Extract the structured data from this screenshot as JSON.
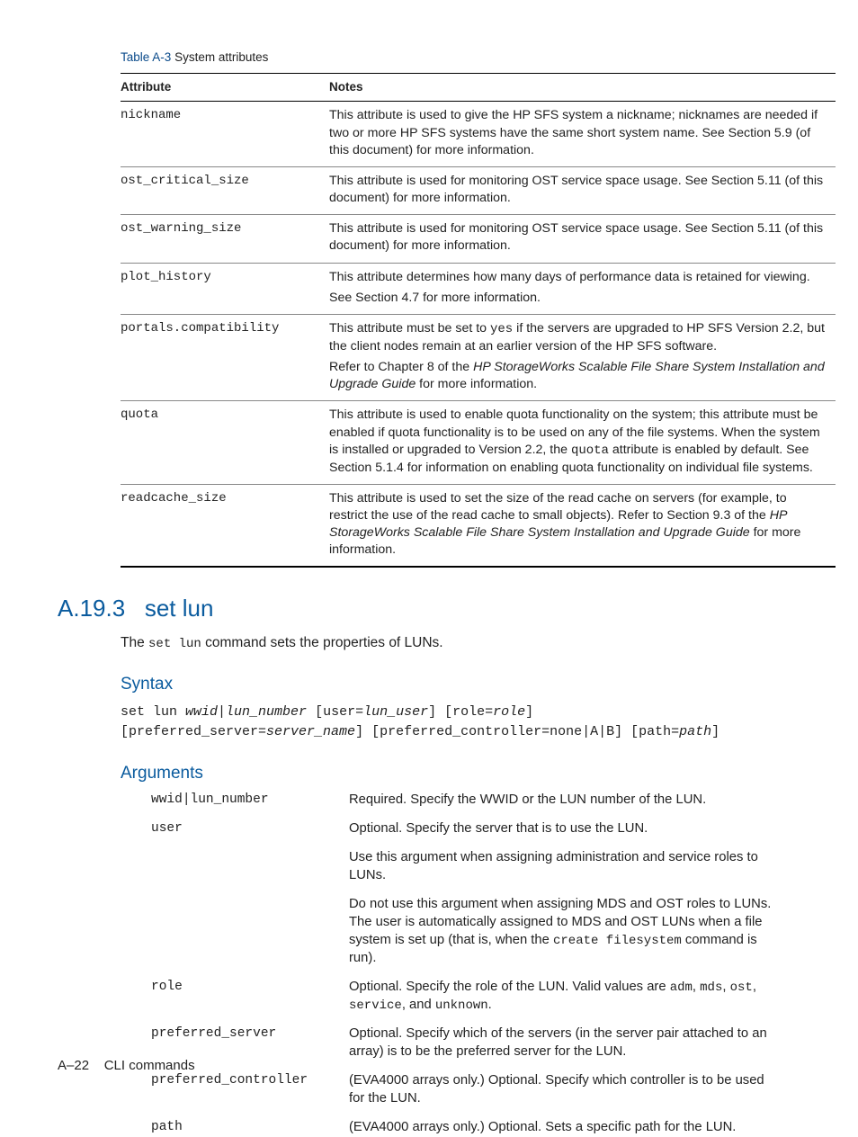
{
  "table": {
    "label": "Table A-3",
    "title": "System attributes",
    "headers": {
      "attr": "Attribute",
      "notes": "Notes"
    },
    "rows": [
      {
        "attr": "nickname",
        "notes_html": "This attribute is used to give the HP SFS system a nickname; nicknames are needed if two or more HP SFS systems have the same short system name. See Section 5.9 (of this document) for more information."
      },
      {
        "attr": "ost_critical_size",
        "notes_html": "This attribute is used for monitoring OST service space usage. See Section 5.11 (of this document) for more information."
      },
      {
        "attr": "ost_warning_size",
        "notes_html": "This attribute is used for monitoring OST service space usage. See Section 5.11 (of this document) for more information."
      },
      {
        "attr": "plot_history",
        "notes_html": "<p>This attribute determines how many days of performance data is retained for viewing.</p><p>See Section 4.7 for more information.</p>"
      },
      {
        "attr": "portals.compatibility",
        "notes_html": "<p>This attribute must be set to <span class=\"mono\">yes</span> if the servers are upgraded to HP SFS Version 2.2, but the client nodes remain at an earlier version of the HP SFS software.</p><p>Refer to Chapter 8 of the <span class=\"italic\">HP StorageWorks Scalable File Share System Installation and Upgrade Guide</span> for more information.</p>"
      },
      {
        "attr": "quota",
        "notes_html": "This attribute is used to enable quota functionality on the system; this attribute must be enabled if quota functionality is to be used on any of the file systems. When the system is installed or upgraded to Version 2.2, the <span class=\"mono\">quota</span> attribute is enabled by default. See Section 5.1.4 for information on enabling quota functionality on individual file systems."
      },
      {
        "attr": "readcache_size",
        "notes_html": "This attribute is used to set the size of the read cache on servers (for example, to restrict the use of the read cache to small objects). Refer to Section 9.3 of the <span class=\"italic\">HP StorageWorks Scalable File Share System Installation and Upgrade Guide</span> for more information."
      }
    ]
  },
  "section": {
    "number": "A.19.3",
    "title": "set lun",
    "intro_pre": "The ",
    "intro_cmd": "set lun",
    "intro_post": " command sets the properties of LUNs."
  },
  "syntax": {
    "heading": "Syntax",
    "html": "set lun <span class=\"ital\">wwid</span>|<span class=\"ital\">lun_number</span> [user=<span class=\"ital\">lun_user</span>] [role=<span class=\"ital\">role</span>]\n[preferred_server=<span class=\"ital\">server_name</span>] [preferred_controller=none|A|B] [path=<span class=\"ital\">path</span>]"
  },
  "arguments": {
    "heading": "Arguments",
    "rows": [
      {
        "name_html": "<span class=\"ital\">wwid</span>|<span class=\"ital\">lun_number</span>",
        "desc_html": "Required. Specify the WWID or the LUN number of the LUN."
      },
      {
        "name_html": "user",
        "desc_html": "<p>Optional. Specify the server that is to use the LUN.</p><p>Use this argument when assigning administration and service roles to LUNs.</p><p>Do not use this argument when assigning MDS and OST roles to LUNs. The user is automatically assigned to MDS and OST LUNs when a file system is set up (that is, when the <span class=\"mono\">create filesystem</span> command is run).</p>"
      },
      {
        "name_html": "role",
        "desc_html": "Optional. Specify the role of the LUN. Valid values are <span class=\"mono\">adm</span>, <span class=\"mono\">mds</span>, <span class=\"mono\">ost</span>, <span class=\"mono\">service</span>, and <span class=\"mono\">unknown</span>."
      },
      {
        "name_html": "preferred_server",
        "desc_html": "Optional. Specify which of the servers (in the server pair attached to an array) is to be the preferred server for the LUN."
      },
      {
        "name_html": "preferred_controller",
        "desc_html": "(EVA4000 arrays only.) Optional. Specify which controller is to be used for the LUN."
      },
      {
        "name_html": "path",
        "desc_html": "(EVA4000 arrays only.) Optional. Sets a specific path for the LUN."
      }
    ]
  },
  "footer": {
    "page": "A–22",
    "section": "CLI commands"
  }
}
